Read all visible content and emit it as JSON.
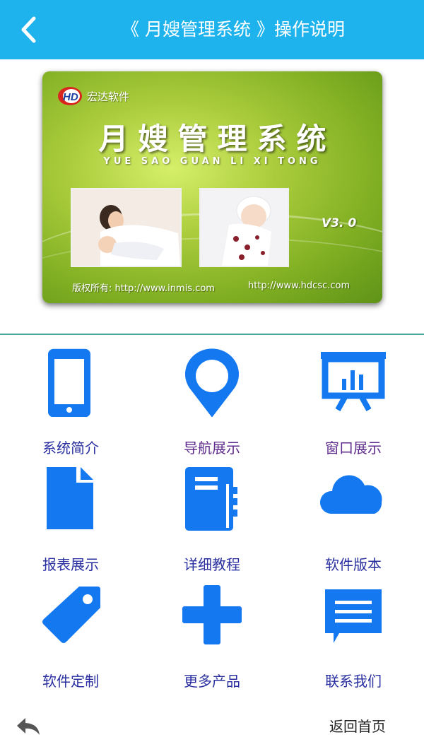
{
  "header": {
    "title": "《 月嫂管理系统 》操作说明",
    "back_icon": "chevron-left-icon",
    "color": "#1eb3ec"
  },
  "banner": {
    "brand_name": "宏达软件",
    "brand_logo_letters": "HD",
    "product_name": "月嫂管理系统",
    "product_pinyin": "YUE SAO GUAN LI XI TONG",
    "version": "V3. 0",
    "copyright": "版权所有:  http://www.inmis.com",
    "url2": "http://www.hdcsc.com"
  },
  "menu": {
    "icon_color": "#1478f0",
    "items": [
      {
        "label": "系统简介",
        "icon": "phone-icon"
      },
      {
        "label": "导航展示",
        "icon": "location-pin-icon"
      },
      {
        "label": "窗口展示",
        "icon": "presentation-chart-icon"
      },
      {
        "label": "报表展示",
        "icon": "document-icon"
      },
      {
        "label": "详细教程",
        "icon": "notebook-icon"
      },
      {
        "label": "软件版本",
        "icon": "cloud-icon"
      },
      {
        "label": "软件定制",
        "icon": "tag-icon"
      },
      {
        "label": "更多产品",
        "icon": "plus-icon"
      },
      {
        "label": "联系我们",
        "icon": "message-icon"
      }
    ]
  },
  "footer": {
    "back_icon": "reply-arrow-icon",
    "home_label": "返回首页"
  }
}
